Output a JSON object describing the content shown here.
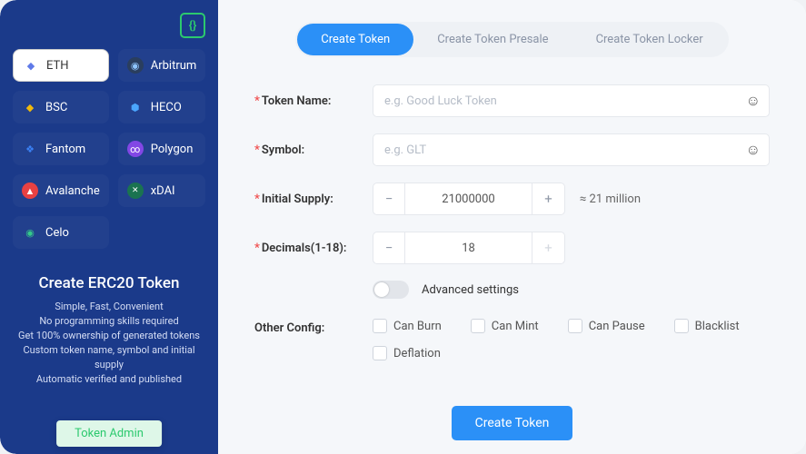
{
  "sidebar": {
    "logo_glyph": "{}",
    "networks": [
      {
        "label": "ETH",
        "icon": "◆",
        "iconClass": "i-eth",
        "selected": true
      },
      {
        "label": "Arbitrum",
        "icon": "◉",
        "iconClass": "i-arb"
      },
      {
        "label": "BSC",
        "icon": "◆",
        "iconClass": "i-bsc"
      },
      {
        "label": "HECO",
        "icon": "⬢",
        "iconClass": "i-heco"
      },
      {
        "label": "Fantom",
        "icon": "❖",
        "iconClass": "i-ftm"
      },
      {
        "label": "Polygon",
        "icon": "∞",
        "iconClass": "i-poly"
      },
      {
        "label": "Avalanche",
        "icon": "▲",
        "iconClass": "i-avax"
      },
      {
        "label": "xDAI",
        "icon": "✕",
        "iconClass": "i-xdai"
      },
      {
        "label": "Celo",
        "icon": "◉",
        "iconClass": "i-celo"
      }
    ],
    "promo": {
      "title": "Create ERC20 Token",
      "lines": "Simple, Fast, Convenient\nNo programming skills required\nGet 100% ownership of generated tokens\nCustom token name, symbol and initial supply\nAutomatic verified and published"
    },
    "token_admin_label": "Token Admin"
  },
  "tabs": [
    {
      "label": "Create Token",
      "active": true
    },
    {
      "label": "Create Token Presale"
    },
    {
      "label": "Create Token Locker"
    }
  ],
  "form": {
    "token_name": {
      "label": "Token Name:",
      "placeholder": "e.g. Good Luck Token",
      "value": ""
    },
    "symbol": {
      "label": "Symbol:",
      "placeholder": "e.g. GLT",
      "value": ""
    },
    "initial_supply": {
      "label": "Initial Supply:",
      "value": "21000000",
      "approx": "≈ 21 million"
    },
    "decimals": {
      "label": "Decimals(1-18):",
      "value": "18"
    },
    "advanced_label": "Advanced settings",
    "other_config_label": "Other Config:",
    "config_options": [
      {
        "label": "Can Burn"
      },
      {
        "label": "Can Mint"
      },
      {
        "label": "Can Pause"
      },
      {
        "label": "Blacklist"
      },
      {
        "label": "Deflation"
      }
    ],
    "submit_label": "Create Token"
  }
}
